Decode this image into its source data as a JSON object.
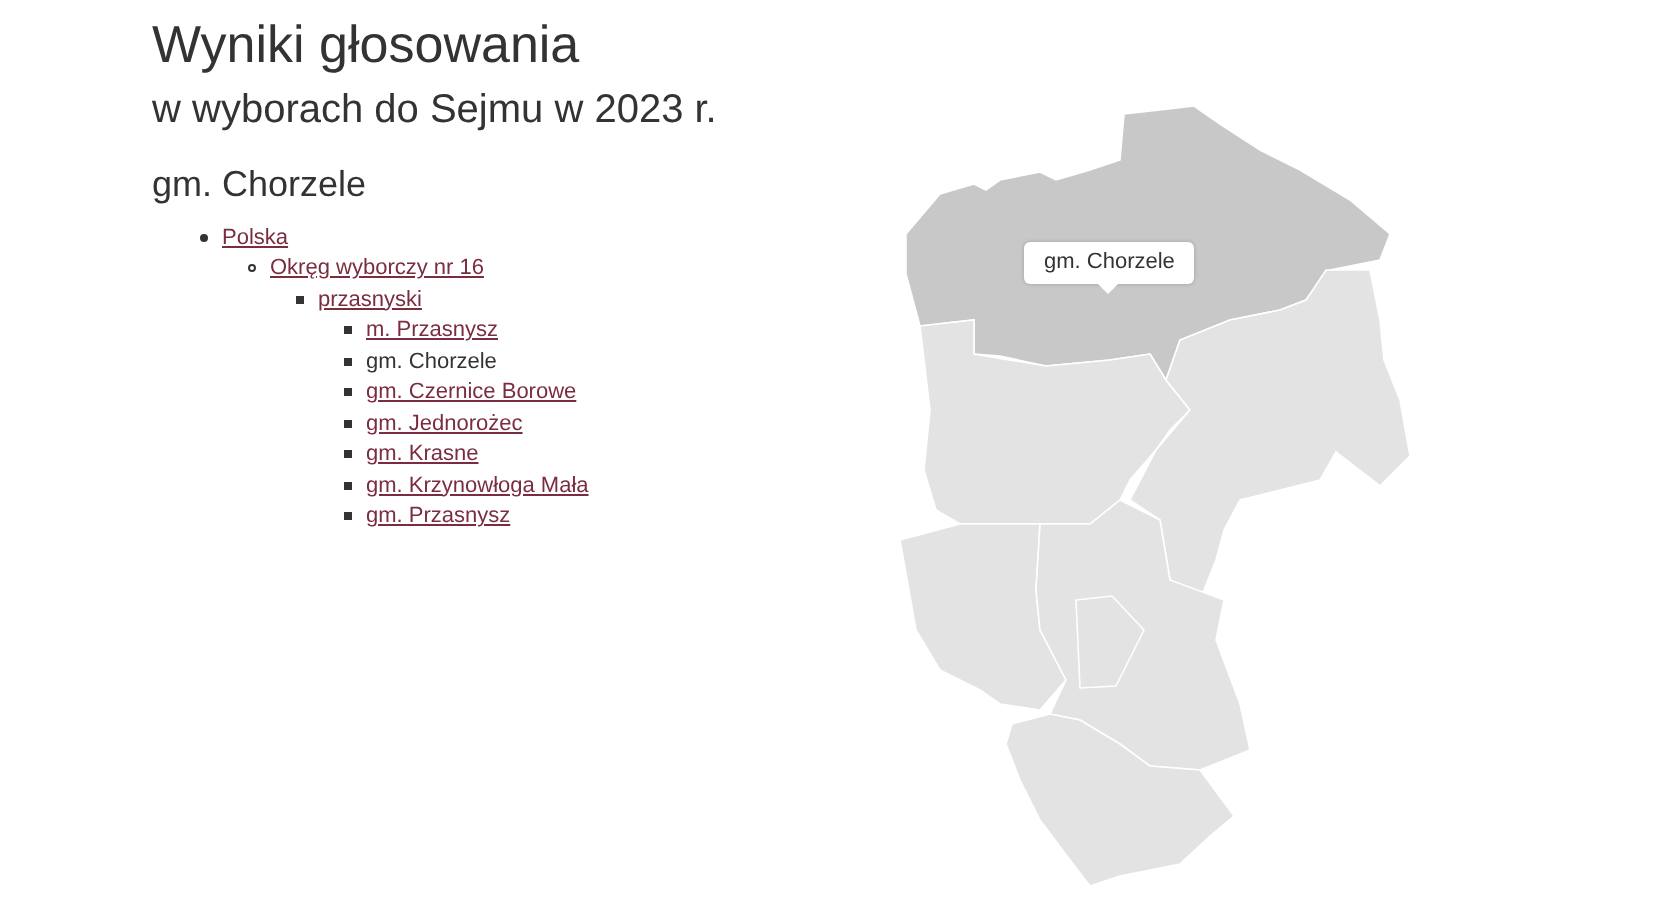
{
  "title": "Wyniki głosowania",
  "subtitle": "w wyborach do Sejmu w 2023 r.",
  "unit": "gm. Chorzele",
  "tree": [
    {
      "label": "Polska",
      "selected": false,
      "children": [
        {
          "label": "Okręg wyborczy nr 16",
          "selected": false,
          "children": [
            {
              "label": "przasnyski",
              "selected": false,
              "children": [
                {
                  "label": "m. Przasnysz",
                  "selected": false
                },
                {
                  "label": "gm. Chorzele",
                  "selected": true
                },
                {
                  "label": "gm. Czernice Borowe",
                  "selected": false
                },
                {
                  "label": "gm. Jednorożec",
                  "selected": false
                },
                {
                  "label": "gm. Krasne",
                  "selected": false
                },
                {
                  "label": "gm. Krzynowłoga Mała",
                  "selected": false
                },
                {
                  "label": "gm. Przasnysz",
                  "selected": false
                }
              ]
            }
          ]
        }
      ]
    }
  ],
  "map": {
    "tooltip": "gm. Chorzele",
    "regions": [
      {
        "selected": true
      },
      {
        "selected": false
      },
      {
        "selected": false
      },
      {
        "selected": false
      },
      {
        "selected": false
      },
      {
        "selected": false
      },
      {
        "selected": false
      }
    ]
  }
}
